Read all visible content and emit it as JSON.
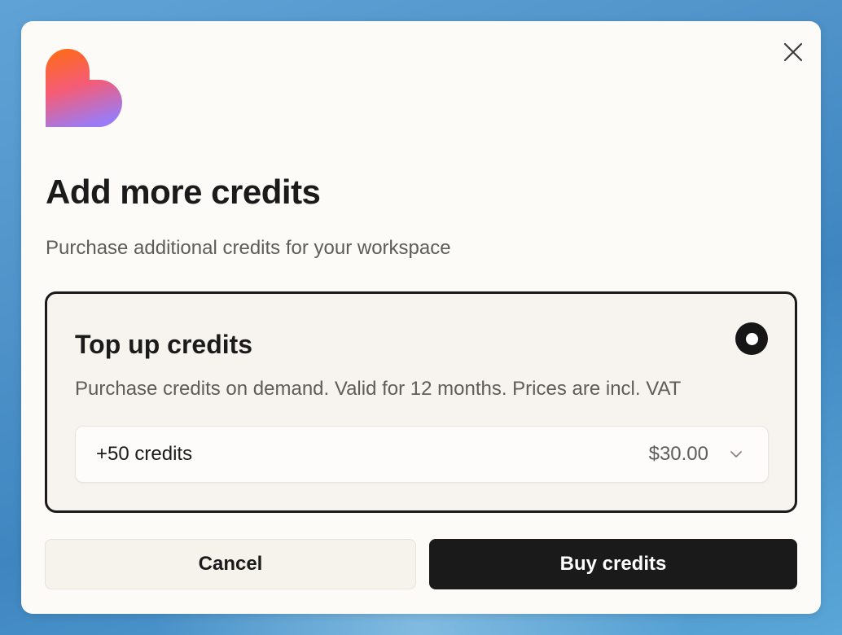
{
  "dialog": {
    "title": "Add more credits",
    "subtitle": "Purchase additional credits for your workspace",
    "close_icon": "close-icon",
    "logo_icon": "heart-logo-icon"
  },
  "option": {
    "title": "Top up credits",
    "description": "Purchase credits on demand. Valid for 12 months. Prices are incl. VAT",
    "selected": true,
    "select": {
      "amount": "+50 credits",
      "price": "$30.00",
      "icon": "chevron-down-icon"
    }
  },
  "actions": {
    "cancel_label": "Cancel",
    "buy_label": "Buy credits"
  },
  "colors": {
    "backdrop": "#4e92c9",
    "modal_bg": "#fcfbf8",
    "card_bg": "#f7f4ef",
    "primary": "#1a1a1a",
    "logo_gradient": [
      "#ff6a1a",
      "#f25c7a",
      "#9b7bf5"
    ]
  }
}
